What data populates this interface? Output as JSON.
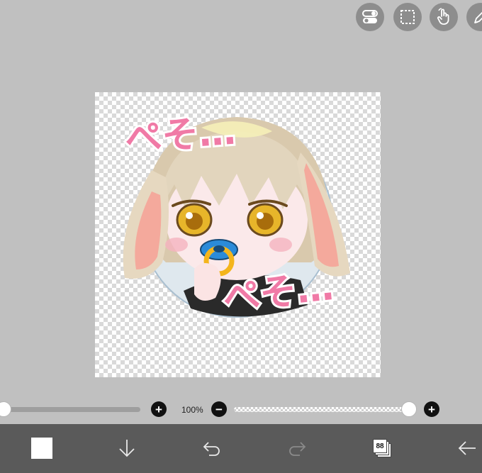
{
  "toolbar_top": {
    "tools": [
      {
        "id": "toggle-panel",
        "icon": "toggle-switch-icon"
      },
      {
        "id": "selection",
        "icon": "dashed-selection-icon"
      },
      {
        "id": "touch",
        "icon": "hand-pointer-icon"
      },
      {
        "id": "pen",
        "icon": "pen-icon"
      }
    ]
  },
  "canvas": {
    "artwork": {
      "caption_top": "ぺそ…",
      "caption_bottom": "ぺそ…"
    }
  },
  "controls": {
    "zoom_label": "100%",
    "plus_symbol": "+",
    "minus_symbol": "−",
    "brush_size_level": 0.0,
    "opacity_level": 1.0
  },
  "bottom_bar": {
    "color_swatch": "#ffffff",
    "layers_count": "88",
    "icons": [
      "down-arrow-icon",
      "undo-icon",
      "redo-icon",
      "layers-icon",
      "back-arrow-icon"
    ]
  },
  "colors": {
    "background": "#c0c0c0",
    "bottom_bar": "#5a5a5a",
    "tool_button": "#8d8d8d",
    "caption_pink": "#f07aa6"
  }
}
